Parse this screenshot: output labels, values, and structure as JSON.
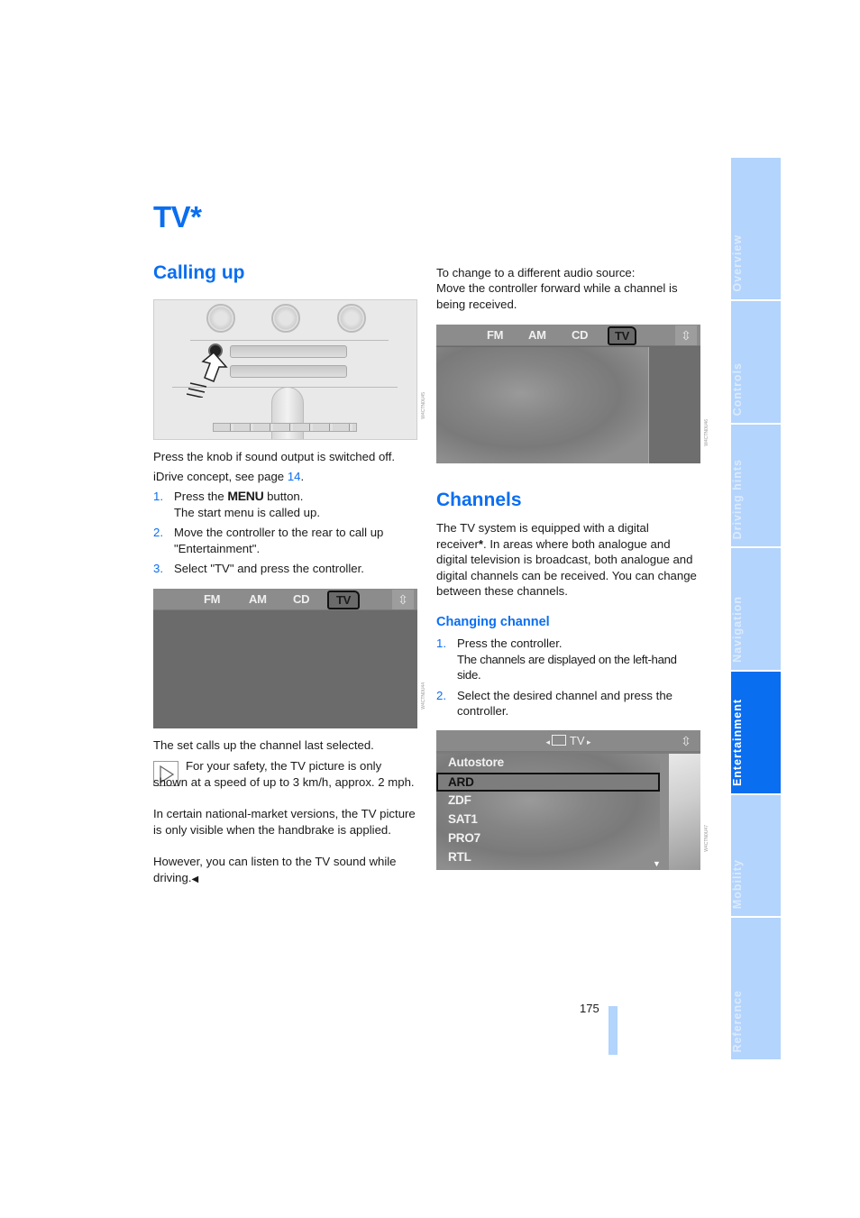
{
  "page": {
    "title": "TV*",
    "number": "175"
  },
  "left_column": {
    "calling_up": {
      "heading": "Calling up",
      "figure_code": "W4CTN0U45",
      "para1": "Press the knob if sound output is switched off.",
      "para2_prefix": "iDrive concept, see page ",
      "para2_link": "14",
      "para2_suffix": ".",
      "steps": [
        {
          "num": "1.",
          "pre": "Press the ",
          "bold": "MENU",
          "post": " button.",
          "line2": "The start menu is called up."
        },
        {
          "num": "2.",
          "text": "Move the controller to the rear to call up \"Entertainment\"."
        },
        {
          "num": "3.",
          "text": "Select \"TV\" and press the controller."
        }
      ]
    },
    "screen1": {
      "sources": [
        "FM",
        "AM",
        "CD",
        "TV"
      ],
      "active_source": "TV",
      "nav_icon": "controller-icon",
      "figure_code": "W4CTN0U44"
    },
    "after_screen": "The set calls up the channel last selected.",
    "note": {
      "icon": "note-triangle-icon",
      "text": "For your safety, the TV picture is only shown at a speed of up to 3 km/h, approx. 2 mph.",
      "para2": "In certain national-market versions, the TV picture is only visible when the handbrake is applied.",
      "para3": "However, you can listen to the TV sound while driving.",
      "end_mark": "◀"
    }
  },
  "right_column": {
    "audio_source": {
      "line1": "To change to a different audio source:",
      "line2": "Move the controller forward while a channel is being received."
    },
    "screen2": {
      "sources": [
        "FM",
        "AM",
        "CD",
        "TV"
      ],
      "active_source": "TV",
      "nav_icon": "controller-icon",
      "figure_code": "W4CTN0U46"
    },
    "channels": {
      "heading": "Channels",
      "para_pre": "The TV system is equipped with a digital receiver",
      "para_star": "*",
      "para_post": ". In areas where both analogue and digital television is broadcast, both analogue and digital channels can be received. You can change between these channels."
    },
    "changing_channel": {
      "heading": "Changing channel",
      "steps": [
        {
          "num": "1.",
          "text": "Press the controller.",
          "line2": "The channels are displayed on the left-hand side."
        },
        {
          "num": "2.",
          "text": "Select the desired channel and press the controller."
        }
      ]
    },
    "screen3": {
      "header": "TV",
      "items": [
        "Autostore",
        "ARD",
        "ZDF",
        "SAT1",
        "PRO7",
        "RTL"
      ],
      "selected": "ARD",
      "figure_code": "W4CTN0U47"
    }
  },
  "side_tabs": {
    "items": [
      {
        "label": "Overview",
        "active": false
      },
      {
        "label": "Controls",
        "active": false
      },
      {
        "label": "Driving hints",
        "active": false
      },
      {
        "label": "Navigation",
        "active": false
      },
      {
        "label": "Entertainment",
        "active": true
      },
      {
        "label": "Mobility",
        "active": false
      },
      {
        "label": "Reference",
        "active": false
      }
    ],
    "active_color": "#0a6ef0",
    "inactive_color": "#b3d4fc"
  },
  "colors": {
    "accent": "#0a6ef0",
    "text": "#1a1a1a"
  }
}
